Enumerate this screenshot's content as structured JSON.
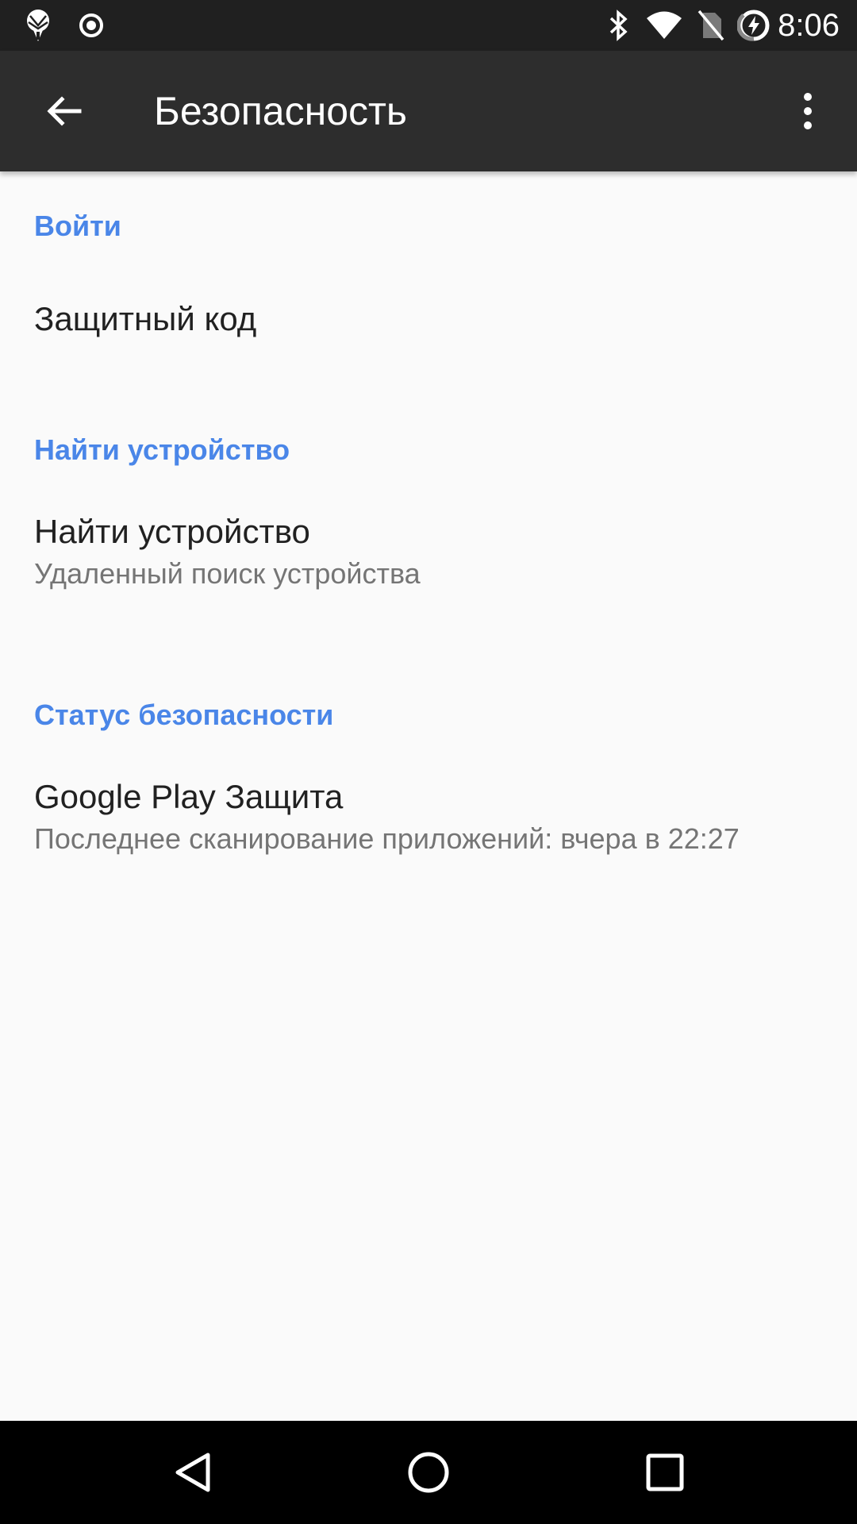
{
  "status_bar": {
    "time": "8:06",
    "icons": [
      "app-notification-icon",
      "circle-dot-icon",
      "bluetooth-icon",
      "wifi-icon",
      "no-sim-icon",
      "battery-charging-icon"
    ]
  },
  "toolbar": {
    "title": "Безопасность",
    "back_icon": "arrow-back-icon",
    "menu_icon": "more-vert-icon"
  },
  "sections": [
    {
      "header": "Войти",
      "items": [
        {
          "title": "Защитный код",
          "summary": ""
        }
      ]
    },
    {
      "header": "Найти устройство",
      "items": [
        {
          "title": "Найти устройство",
          "summary": "Удаленный поиск устройства"
        }
      ]
    },
    {
      "header": "Статус безопасности",
      "items": [
        {
          "title": "Google Play Защита",
          "summary": "Последнее сканирование приложений: вчера в 22:27"
        }
      ]
    }
  ],
  "nav_bar": {
    "buttons": [
      "back-triangle-icon",
      "home-circle-icon",
      "recents-square-icon"
    ]
  },
  "colors": {
    "accent": "#4a86e8",
    "toolbar": "#2d2d2d",
    "status_bar": "#202020",
    "background": "#fafafa"
  }
}
